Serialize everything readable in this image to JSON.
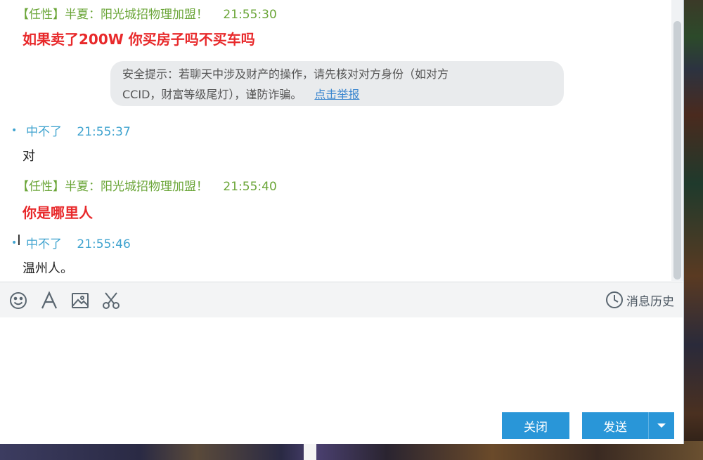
{
  "chat": {
    "messages": [
      {
        "sender": "【任性】半夏：阳光城招物理加盟！",
        "time": "21:55:30",
        "text": "如果卖了200W 你买房子吗不买车吗"
      },
      {
        "sender": "中不了",
        "time": "21:55:37",
        "text": "对"
      },
      {
        "sender": "【任性】半夏：阳光城招物理加盟！",
        "time": "21:55:40",
        "text": "你是哪里人"
      },
      {
        "sender": "中不了",
        "time": "21:55:46",
        "text": "温州人。"
      }
    ],
    "notice": {
      "line1": "安全提示：若聊天中涉及财产的操作，请先核对对方身份（如对方",
      "line2": "CCID，财富等级尾灯），谨防诈骗。",
      "link": "点击举报"
    }
  },
  "toolbar": {
    "icons": [
      "emoji-icon",
      "font-icon",
      "image-icon",
      "scissors-icon",
      "clock-icon"
    ],
    "history_label": "消息历史"
  },
  "buttons": {
    "close_label": "关闭",
    "send_label": "发送"
  },
  "colors": {
    "accent": "#2996d8",
    "sender_green": "#6aa537",
    "sender_blue": "#3fa3cf",
    "message_red": "#e8292b"
  }
}
